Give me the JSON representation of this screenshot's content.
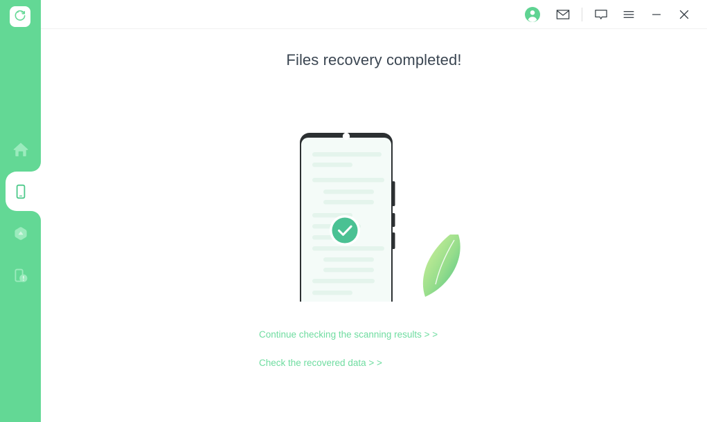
{
  "window": {
    "titlebar_buttons": [
      {
        "name": "account-avatar",
        "icon": "user-circle-icon",
        "label": "Account"
      },
      {
        "name": "mail-button",
        "icon": "envelope-icon",
        "label": "Mail"
      },
      {
        "name": "feedback-button",
        "icon": "speech-bubble-icon",
        "label": "Feedback"
      },
      {
        "name": "menu-button",
        "icon": "hamburger-menu-icon",
        "label": "Menu"
      },
      {
        "name": "minimize-button",
        "icon": "minimize-icon",
        "label": "Minimize"
      },
      {
        "name": "close-button",
        "icon": "close-icon",
        "label": "Close"
      }
    ]
  },
  "sidebar": {
    "logo": {
      "icon": "recovery-refresh-icon",
      "label": "Recovery"
    },
    "items": [
      {
        "label": "Home",
        "icon": "home-icon",
        "active": false
      },
      {
        "label": "Phone Recovery",
        "icon": "smartphone-icon",
        "active": true
      },
      {
        "label": "Cloud Recovery",
        "icon": "cloud-upload-icon",
        "active": false
      },
      {
        "label": "System Repair",
        "icon": "device-repair-icon",
        "active": false
      }
    ]
  },
  "main": {
    "title": "Files recovery completed!",
    "illustration": {
      "name": "phone-success-illustration",
      "badge_icon": "check-circle-icon"
    },
    "links": [
      {
        "label": "Continue checking the scanning results > >",
        "name": "continue-scanning-link"
      },
      {
        "label": "Check the recovered data > >",
        "name": "check-recovered-data-link"
      }
    ]
  },
  "colors": {
    "sidebar_green": "#63d895",
    "link_green": "#6fdca0",
    "badge_green": "#4ac193",
    "title_text": "#3b4652",
    "phone_frame": "#2c3032",
    "screen_bg": "#f4fbf8"
  }
}
